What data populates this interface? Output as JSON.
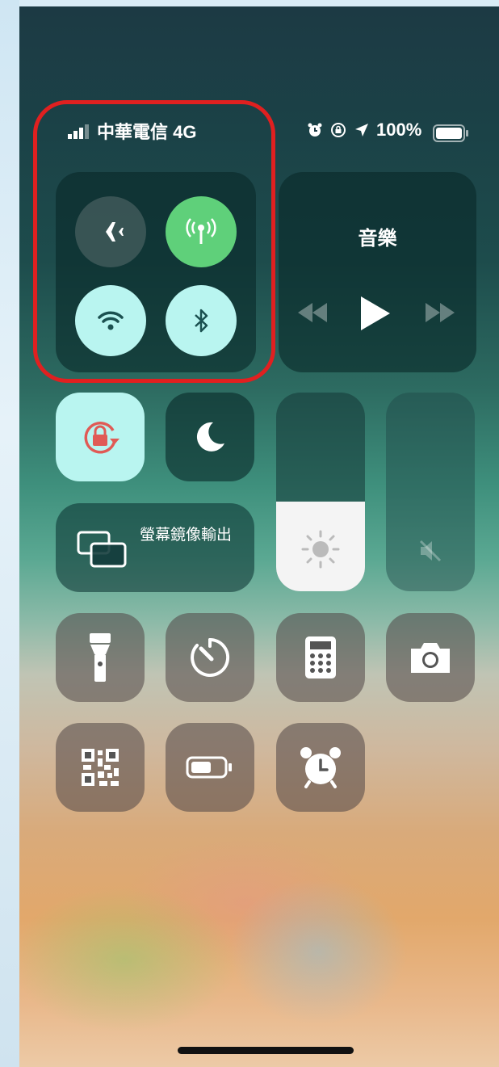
{
  "status_bar": {
    "carrier": "中華電信 4G",
    "battery_percent": "100%",
    "icons": [
      "alarm-icon",
      "orientation-lock-icon",
      "location-arrow-icon",
      "battery-icon"
    ]
  },
  "connectivity": {
    "airplane_mode": false,
    "cellular_data": true,
    "wifi": true,
    "bluetooth": true
  },
  "music": {
    "title": "音樂"
  },
  "screen_mirroring": {
    "label": "螢幕鏡像輸出"
  },
  "brightness_level": 0.45,
  "volume_muted": true,
  "controls": [
    "flashlight-icon",
    "timer-icon",
    "calculator-icon",
    "camera-icon",
    "qr-code-icon",
    "low-power-icon",
    "alarm-clock-icon"
  ],
  "colors": {
    "highlight": "#e02020",
    "cellular_on": "#5fd07a",
    "toggle_on": "#b9f5f0",
    "rotation_lock": "#e05a55"
  }
}
